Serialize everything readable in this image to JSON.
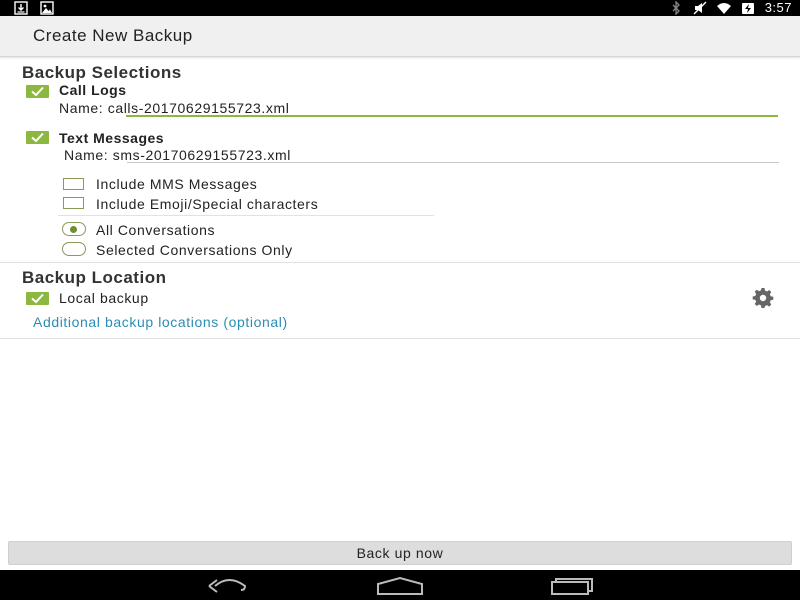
{
  "status_bar": {
    "time": "3:57",
    "left_icons": [
      "download-icon",
      "image-icon"
    ],
    "right_icons": [
      "bluetooth-icon",
      "mute-icon",
      "wifi-icon",
      "battery-charging-icon"
    ]
  },
  "action_bar": {
    "title": "Create New Backup"
  },
  "backup_selections": {
    "title": "Backup Selections",
    "call_logs": {
      "label": "Call Logs",
      "checked": true,
      "name_prefix": "Name:",
      "name_value": "calls-20170629155723.xml"
    },
    "text_messages": {
      "label": "Text Messages",
      "checked": true,
      "name_prefix": "Name:",
      "name_value": "sms-20170629155723.xml",
      "options": [
        {
          "label": "Include MMS Messages",
          "checked": false
        },
        {
          "label": "Include Emoji/Special characters",
          "checked": false
        }
      ],
      "conversations": [
        {
          "label": "All Conversations",
          "selected": true
        },
        {
          "label": "Selected Conversations Only",
          "selected": false
        }
      ]
    }
  },
  "backup_location": {
    "title": "Backup Location",
    "local_backup": {
      "label": "Local backup",
      "checked": true
    },
    "additional_link": "Additional backup locations (optional)"
  },
  "actions": {
    "backup_now": "Back up now"
  },
  "nav_bar": {
    "buttons": [
      "back-icon",
      "home-icon",
      "recents-icon"
    ]
  },
  "colors": {
    "accent_green": "#8cb740",
    "link_blue": "#2b8db5",
    "actionbar_bg": "#f0f0f0",
    "statusbar_bg": "#000000"
  }
}
